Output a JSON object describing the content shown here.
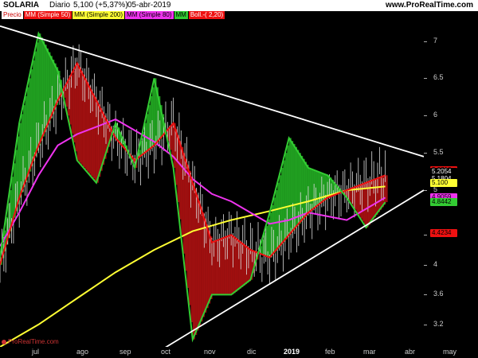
{
  "header": {
    "ticker": "SOLARIA",
    "period": "Diario",
    "last": "5,100 (+5,37%)",
    "date": "05-abr-2019",
    "site": "www.ProRealTime.com"
  },
  "legend": [
    {
      "label": "Precio",
      "bg": "#ffffff",
      "fg": "#cc0000"
    },
    {
      "label": "MM (Simple 50)",
      "bg": "#ee1111",
      "fg": "#ffffff"
    },
    {
      "label": "MM (Simple 200)",
      "bg": "#ffff33",
      "fg": "#000000"
    },
    {
      "label": "MM (Simple 80)",
      "bg": "#ee33ee",
      "fg": "#000000"
    },
    {
      "label": "MM",
      "bg": "#33cc33",
      "fg": "#000000"
    },
    {
      "label": "Boll.-( 2,20)",
      "bg": "#ee1111",
      "fg": "#ffffff"
    }
  ],
  "watermark": "ProRealTime.com",
  "colors": {
    "background": "#000000",
    "bull_fill": "#22aa22",
    "bear_fill": "#aa1111",
    "ma50": "#ee1111",
    "ma200": "#ffff33",
    "ma80": "#ee33ee",
    "boll_mid": "#33cc33",
    "trendline": "#ffffff"
  },
  "chart_data": {
    "type": "line",
    "title": "SOLARIA Diario",
    "y_axis": {
      "ticks": [
        7,
        6.5,
        6,
        5.5,
        5,
        4.4,
        4,
        3.6,
        3.2
      ],
      "tick_labels": [
        "7",
        "6.5",
        "6",
        "5.5",
        "5",
        "4.4",
        "4",
        "3.6",
        "3.2"
      ],
      "range": [
        2.9,
        7.4
      ]
    },
    "x_axis": {
      "labels": [
        "jul",
        "ago",
        "sep",
        "oct",
        "nov",
        "dic",
        "2019",
        "feb",
        "mar",
        "abr",
        "may"
      ]
    },
    "price_labels": [
      {
        "text": "5.2718",
        "value": 5.27,
        "bg": "#ee1111",
        "fg": "#000000"
      },
      {
        "text": "5.2054",
        "value": 5.21,
        "bg": "#000000",
        "fg": "#ffffff"
      },
      {
        "text": "5.1804",
        "value": 5.18,
        "bg": "#000000",
        "fg": "#ffffff"
      },
      {
        "text": "5.100",
        "value": 5.1,
        "bg": "#ffff33",
        "fg": "#000000"
      },
      {
        "text": "4.9059",
        "value": 4.91,
        "bg": "#ee33ee",
        "fg": "#000000"
      },
      {
        "text": "4.8442",
        "value": 4.84,
        "bg": "#33cc33",
        "fg": "#000000"
      },
      {
        "text": "4.4234",
        "value": 4.42,
        "bg": "#ee1111",
        "fg": "#000000"
      }
    ],
    "series": [
      {
        "name": "MM (Simple 200)",
        "color": "#ffff33",
        "x": [
          0,
          20,
          40,
          60,
          80,
          100,
          120,
          140,
          160,
          180,
          200
        ],
        "y": [
          2.9,
          3.2,
          3.55,
          3.9,
          4.2,
          4.45,
          4.6,
          4.72,
          4.85,
          5.0,
          5.05
        ]
      },
      {
        "name": "MM (Simple 80)",
        "color": "#ee33ee",
        "x": [
          0,
          10,
          20,
          30,
          40,
          50,
          60,
          70,
          80,
          90,
          100,
          110,
          120,
          130,
          140,
          150,
          160,
          170,
          180,
          190,
          200
        ],
        "y": [
          4.25,
          4.7,
          5.2,
          5.6,
          5.75,
          5.85,
          5.95,
          5.8,
          5.65,
          5.45,
          5.15,
          4.95,
          4.85,
          4.7,
          4.55,
          4.6,
          4.7,
          4.65,
          4.6,
          4.75,
          4.9
        ]
      },
      {
        "name": "MM (Simple 50)",
        "color": "#ee1111",
        "x": [
          0,
          10,
          20,
          30,
          40,
          50,
          60,
          70,
          80,
          90,
          100,
          110,
          120,
          130,
          140,
          150,
          160,
          170,
          180,
          190,
          200
        ],
        "y": [
          4.0,
          4.9,
          5.6,
          6.2,
          6.7,
          6.2,
          5.7,
          5.4,
          5.6,
          5.9,
          5.1,
          4.3,
          4.4,
          4.2,
          4.1,
          4.4,
          4.7,
          4.9,
          5.0,
          5.1,
          5.2
        ]
      },
      {
        "name": "MM",
        "color": "#33cc33",
        "x": [
          0,
          10,
          20,
          30,
          40,
          50,
          60,
          70,
          80,
          90,
          100,
          110,
          120,
          130,
          140,
          150,
          160,
          170,
          180,
          190,
          200
        ],
        "y": [
          4.1,
          5.9,
          7.1,
          6.6,
          5.4,
          5.1,
          5.9,
          5.3,
          6.5,
          5.3,
          3.0,
          3.6,
          3.6,
          3.8,
          4.7,
          5.7,
          5.3,
          5.2,
          4.9,
          4.5,
          4.84
        ]
      }
    ],
    "trendlines": [
      {
        "name": "upper",
        "color": "#ffffff",
        "from": [
          0,
          7.2
        ],
        "to": [
          220,
          5.45
        ]
      },
      {
        "name": "lower",
        "color": "#ffffff",
        "from": [
          80,
          2.8
        ],
        "to": [
          220,
          5.0
        ]
      }
    ]
  }
}
